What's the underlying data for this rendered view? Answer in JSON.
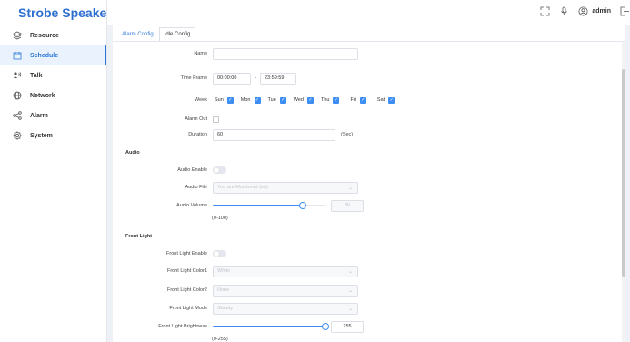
{
  "brand": {
    "title": "Strobe Speaker"
  },
  "sidebar": {
    "items": [
      {
        "label": "Resource",
        "icon": "layers-icon"
      },
      {
        "label": "Schedule",
        "icon": "calendar-icon",
        "active": true
      },
      {
        "label": "Talk",
        "icon": "talk-icon"
      },
      {
        "label": "Network",
        "icon": "globe-icon"
      },
      {
        "label": "Alarm",
        "icon": "share-icon"
      },
      {
        "label": "System",
        "icon": "gear-icon"
      }
    ]
  },
  "header": {
    "user": "admin",
    "icons": [
      "fullscreen-icon",
      "microphone-icon",
      "user-circle-icon",
      "logout-icon"
    ]
  },
  "tabs": [
    {
      "label": "Alarm Config",
      "active": true
    },
    {
      "label": "Idle Config",
      "active": false
    }
  ],
  "form": {
    "name": {
      "label": "Name",
      "value": ""
    },
    "time_frame": {
      "label": "Time Frame",
      "start": "00:00:00",
      "separator": "-",
      "end": "23:59:59"
    },
    "week": {
      "label": "Week",
      "days": [
        {
          "label": "Sun",
          "checked": true
        },
        {
          "label": "Mon",
          "checked": true
        },
        {
          "label": "Tue",
          "checked": true
        },
        {
          "label": "Wed",
          "checked": true
        },
        {
          "label": "Thu",
          "checked": true
        },
        {
          "label": "Fri",
          "checked": true
        },
        {
          "label": "Sat",
          "checked": true
        }
      ]
    },
    "alarm_out": {
      "label": "Alarm Out",
      "checked": false
    },
    "duration": {
      "label": "Duration",
      "value": "60",
      "unit": "(Sec)"
    }
  },
  "audio": {
    "section_title": "Audio",
    "enable": {
      "label": "Audio Enable",
      "on": false
    },
    "file": {
      "label": "Audio File",
      "placeholder": "You are Monitored (en)"
    },
    "volume": {
      "label": "Audio Volume",
      "value": "80",
      "fraction": 0.8,
      "range_hint": "(0-100)"
    }
  },
  "front_light": {
    "section_title": "Front Light",
    "enable": {
      "label": "Front Light Enable",
      "on": false
    },
    "color1": {
      "label": "Front Light Color1",
      "value": "White"
    },
    "color2": {
      "label": "Front Light Color2",
      "value": "None"
    },
    "mode": {
      "label": "Front Light Mode",
      "value": "Steady"
    },
    "brightness": {
      "label": "Front Light Brightness",
      "value": "255",
      "fraction": 1.0,
      "range_hint": "(0-255)"
    }
  },
  "colors": {
    "accent": "#3c8ef3",
    "brand": "#2d6fd1"
  }
}
